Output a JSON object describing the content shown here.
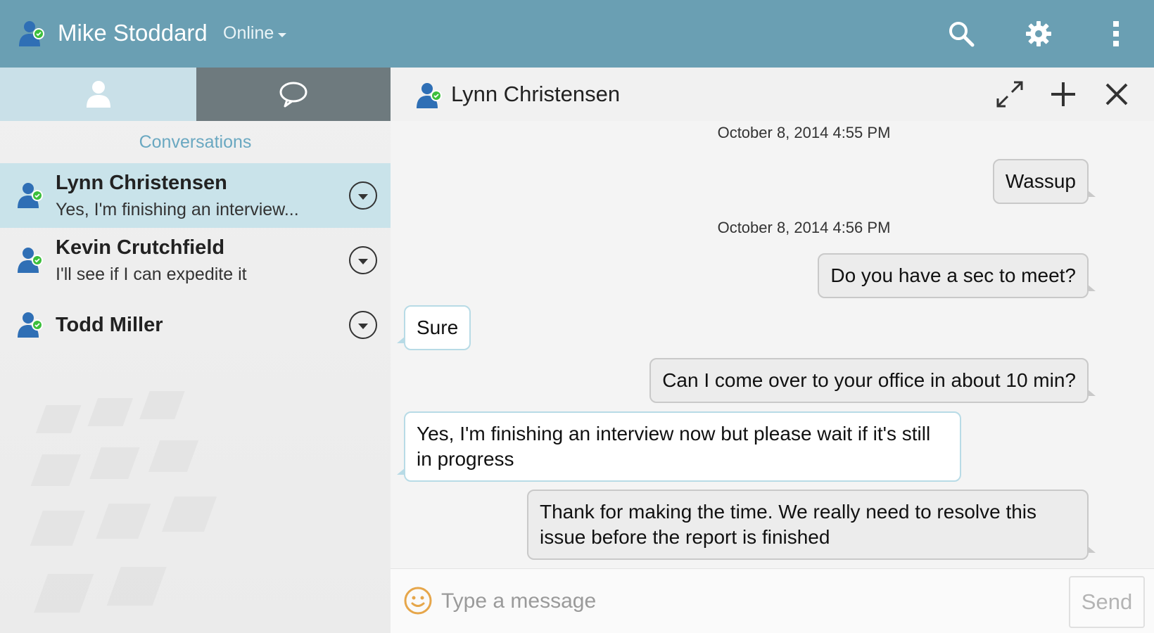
{
  "header": {
    "user_name": "Mike Stoddard",
    "status": "Online",
    "icons": [
      "person-icon",
      "search-icon",
      "gear-icon",
      "overflow-menu-icon"
    ]
  },
  "sidebar": {
    "tabs": [
      {
        "icon": "person-icon",
        "selected": false
      },
      {
        "icon": "chat-bubble-icon",
        "selected": true
      }
    ],
    "section_title": "Conversations",
    "conversations": [
      {
        "name": "Lynn Christensen",
        "preview": "Yes, I'm finishing an interview...",
        "active": true
      },
      {
        "name": "Kevin Crutchfield",
        "preview": "I'll see if I can expedite it",
        "active": false
      },
      {
        "name": "Todd Miller",
        "preview": "",
        "active": false
      }
    ]
  },
  "chat": {
    "title": "Lynn Christensen",
    "icons": [
      "expand-icon",
      "add-icon",
      "close-icon"
    ],
    "timestamps": [
      "October 8, 2014 4:55 PM",
      "October 8, 2014 4:56 PM"
    ],
    "messages": [
      {
        "direction": "out",
        "text": "Wassup"
      },
      {
        "direction": "out",
        "text": "Do you have a sec to meet?"
      },
      {
        "direction": "in",
        "text": "Sure"
      },
      {
        "direction": "out",
        "text": "Can I come over to your office in about 10 min?"
      },
      {
        "direction": "in",
        "text": "Yes, I'm finishing an interview now but please wait if it's still in progress"
      },
      {
        "direction": "out",
        "text": "Thank for making the time. We really need to resolve this issue before the report is finished"
      }
    ]
  },
  "composer": {
    "placeholder": "Type a message",
    "value": "",
    "send_label": "Send"
  },
  "colors": {
    "header_bg": "#6a9fb3",
    "active_row": "#c9e3ea",
    "section_title": "#6aa8c1",
    "presence_green": "#3cbf3c",
    "avatar_blue": "#2f6fb5"
  }
}
